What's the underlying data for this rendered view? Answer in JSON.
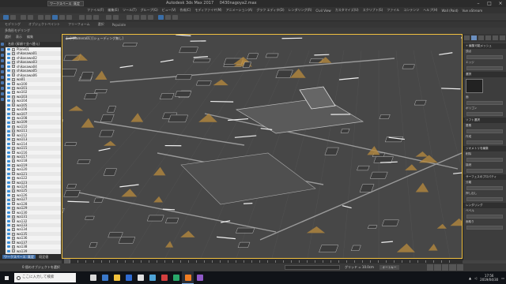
{
  "window": {
    "workspace_dropdown": "ワークスペース: 既定",
    "title_app": "Autodesk 3ds Max 2017",
    "title_file": "0430nagoya2.max",
    "search_placeholder": "キーワードまたは語句を入力"
  },
  "menubar": [
    "ファイル(F)",
    "編集(E)",
    "ツール(T)",
    "グループ(G)",
    "ビュー(V)",
    "作成(C)",
    "モディファイヤ(M)",
    "アニメーション(A)",
    "グラフ エディタ(D)",
    "レンダリング(R)",
    "Civil View",
    "カスタマイズ(U)",
    "スクリプト(S)",
    "ファイル",
    "コンテンツ",
    "ヘルプ(H)",
    "Wall (Paid)",
    "Vue xStream"
  ],
  "ribbon": {
    "tabs": [
      "モデリング",
      "オブジェクトペイント",
      "フリーフォーム",
      "選択",
      "Populate"
    ],
    "sub": [
      "多角形モデリング"
    ]
  },
  "explorer": {
    "tabs": [
      "選択",
      "表示",
      "編集"
    ],
    "header": "名前 (昇順で並べ替え)",
    "items": [
      "Plane01",
      "shikasawa01",
      "shikasawa02",
      "shikasawa03",
      "shikasawa04",
      "shikasawa05",
      "shikasawa06",
      "wa01",
      "wa100",
      "wa101",
      "wa102",
      "wa103",
      "wa104",
      "wa105",
      "wa106",
      "wa107",
      "wa108",
      "wa109",
      "wa110",
      "wa111",
      "wa112",
      "wa113",
      "wa114",
      "wa115",
      "wa116",
      "wa117",
      "wa118",
      "wa119",
      "wa120",
      "wa121",
      "wa122",
      "wa123",
      "wa124",
      "wa125",
      "wa126",
      "wa127",
      "wa128",
      "wa129",
      "wa130",
      "wa131",
      "wa132",
      "wa133",
      "wa134",
      "wa135",
      "wa136",
      "wa137",
      "wa138",
      "wa139"
    ],
    "footer_workspace": "ワークスペース: 既定",
    "footer_tab": "既定値"
  },
  "viewport": {
    "label": "[+] [Camera01] [シェーディング無し]"
  },
  "command_panel": {
    "sections": [
      "+ 編集可能メッシュ",
      "選択",
      "ソフト選択",
      "ジオメトリを編集",
      "サーフェスのプロパティ",
      "レンダリング"
    ],
    "options": [
      "頂点",
      "エッジ",
      "面",
      "ポリゴン",
      "要素",
      "作成",
      "削除",
      "接続",
      "分離",
      "押し出し",
      "ベベル",
      "面取り"
    ]
  },
  "status": {
    "left_text": "0 個のオブジェクトを選択",
    "right_text": "グリッド = 10.0cm",
    "anim_button": "オートキー"
  },
  "taskbar": {
    "search_placeholder": "ここに入力して検索",
    "time": "17:56",
    "date": "2019/04/30",
    "app_colors": [
      "#d9d9d9",
      "#3a78c9",
      "#f2c23c",
      "#2f6bd1",
      "#e0e0e0",
      "#4ea4d8",
      "#d23f3f",
      "#29a86a",
      "#f07c22",
      "#8f59c7"
    ]
  },
  "colors": {
    "accent_blue": "#3b69a2",
    "viewport_border": "#f0c040",
    "roof_gold": "#b98b3c"
  }
}
